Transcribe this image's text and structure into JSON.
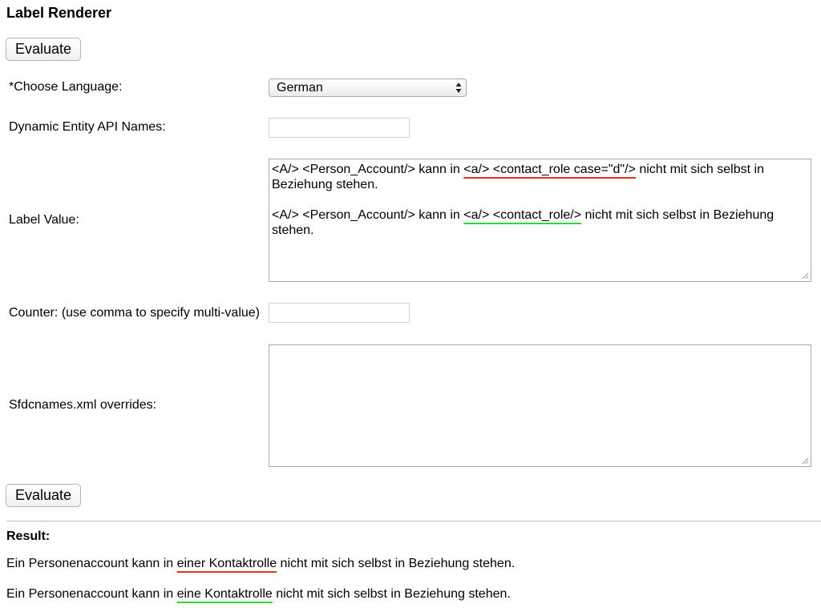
{
  "page": {
    "title": "Label Renderer"
  },
  "buttons": {
    "evaluate_top": "Evaluate",
    "evaluate_bottom": "Evaluate"
  },
  "form": {
    "language": {
      "label": "*Choose Language:",
      "selected": "German"
    },
    "dynamic_entity": {
      "label": "Dynamic Entity API Names:",
      "value": ""
    },
    "label_value": {
      "label": "Label Value:",
      "line1": {
        "pre": "<A/> <Person_Account/> kann in ",
        "highlight": "<a/> <contact_role case=\"d\"/>",
        "post": " nicht mit sich selbst in Beziehung stehen."
      },
      "line2": {
        "pre": "<A/> <Person_Account/> kann in ",
        "highlight": "<a/> <contact_role/>",
        "post": " nicht mit sich selbst in Beziehung stehen."
      }
    },
    "counter": {
      "label": "Counter: (use comma to specify multi-value)",
      "value": ""
    },
    "overrides": {
      "label": "Sfdcnames.xml overrides:",
      "value": ""
    }
  },
  "result": {
    "heading": "Result:",
    "line1": {
      "pre": "Ein Personenaccount kann in ",
      "highlight": "einer Kontaktrolle",
      "post": " nicht mit sich selbst in Beziehung stehen."
    },
    "line2": {
      "pre": "Ein Personenaccount kann in ",
      "highlight": "eine Kontaktrolle",
      "post": " nicht mit sich selbst in Beziehung stehen."
    }
  },
  "colors": {
    "underline_error": "#e8321f",
    "underline_ok": "#2fd92f"
  },
  "icons": {
    "select_arrows": "up-down-arrows-icon",
    "resize": "resize-grip-icon"
  }
}
